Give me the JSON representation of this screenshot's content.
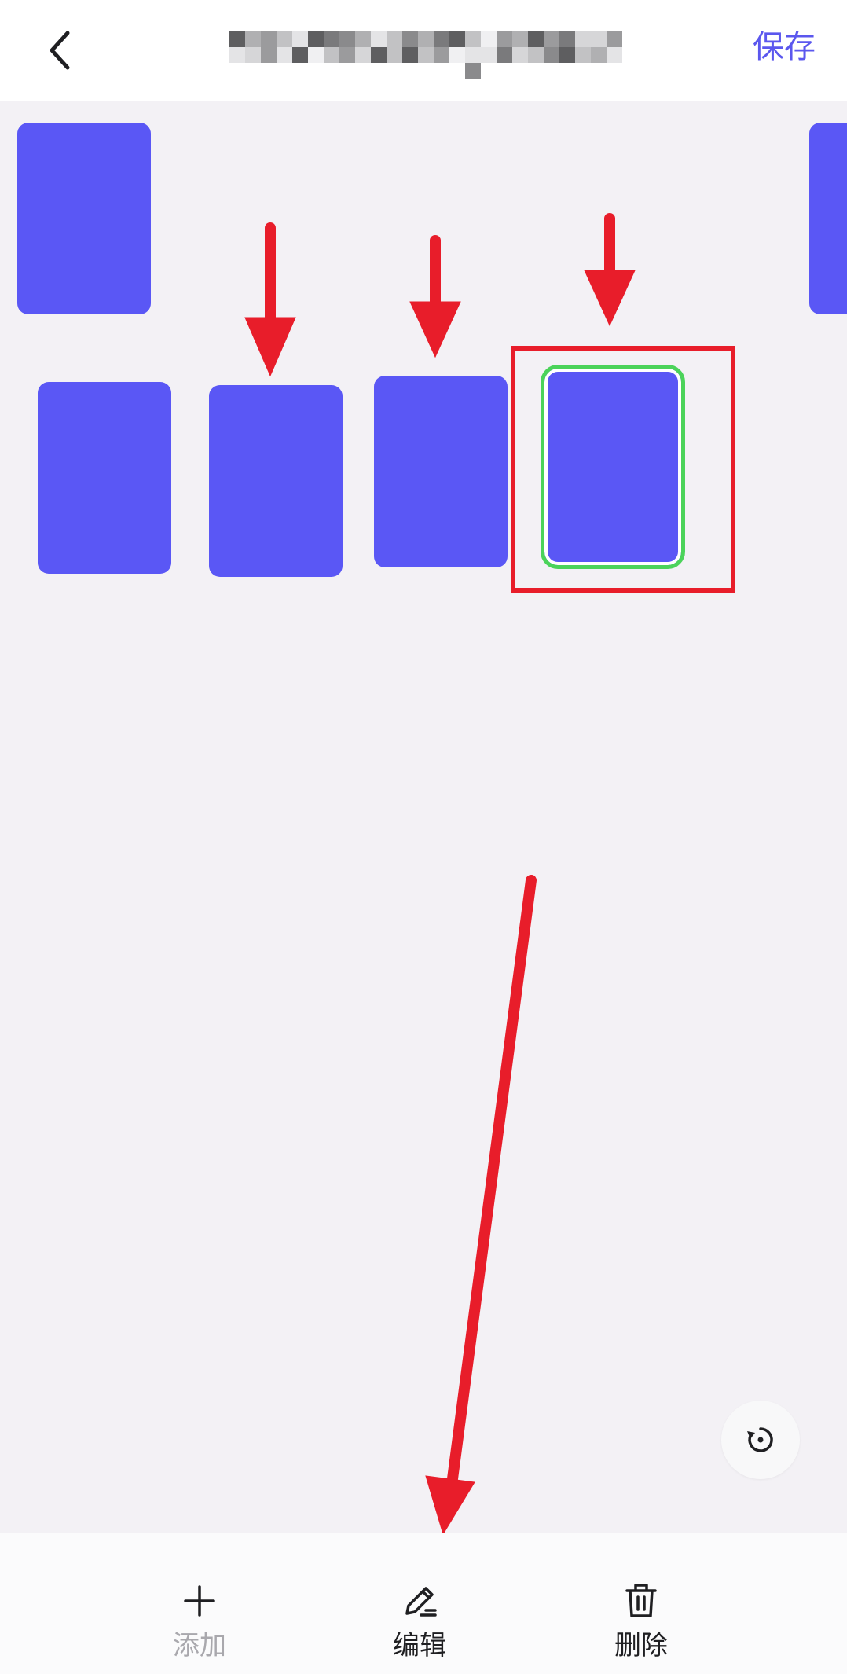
{
  "header": {
    "back_icon": "chevron-left-icon",
    "title": "",
    "save_label": "保存",
    "save_color": "#5b57ee"
  },
  "canvas": {
    "card_color": "#5a57f5",
    "selected_border_color": "#4bd35a",
    "annotation_color": "#e81d2a",
    "card_count": 6,
    "selected_card_index": 5
  },
  "refresh": {
    "icon": "rotate-reset-icon"
  },
  "toolbar": {
    "items": [
      {
        "label": "添加",
        "icon": "plus-icon",
        "enabled": false
      },
      {
        "label": "编辑",
        "icon": "pencil-icon",
        "enabled": true
      },
      {
        "label": "删除",
        "icon": "trash-icon",
        "enabled": true
      }
    ]
  }
}
